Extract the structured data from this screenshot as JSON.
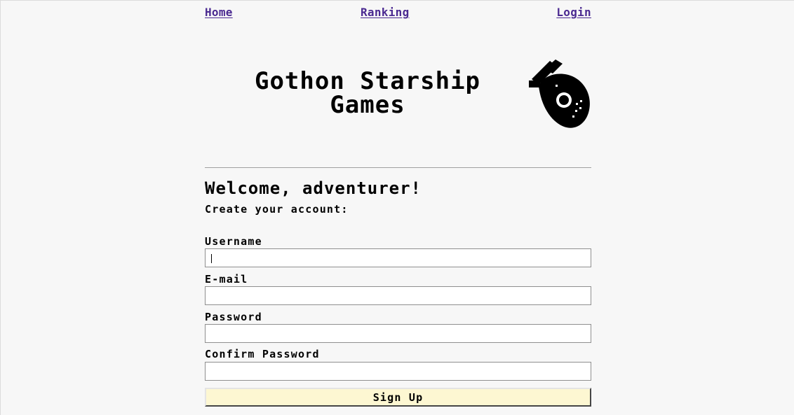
{
  "nav": {
    "home": "Home",
    "ranking": "Ranking",
    "login": "Login"
  },
  "header": {
    "title": "Gothon Starship Games",
    "logo_icon": "spaceship-icon"
  },
  "form": {
    "heading": "Welcome, adventurer!",
    "subtitle": "Create your account:",
    "fields": [
      {
        "label": "Username",
        "value": "",
        "placeholder": ""
      },
      {
        "label": "E-mail",
        "value": "",
        "placeholder": ""
      },
      {
        "label": "Password",
        "value": "",
        "placeholder": ""
      },
      {
        "label": "Confirm Password",
        "value": "",
        "placeholder": ""
      }
    ],
    "submit_label": "Sign Up"
  },
  "colors": {
    "link": "#4b2a91",
    "background": "#f7f7f7",
    "button": "#fdf7d2"
  }
}
